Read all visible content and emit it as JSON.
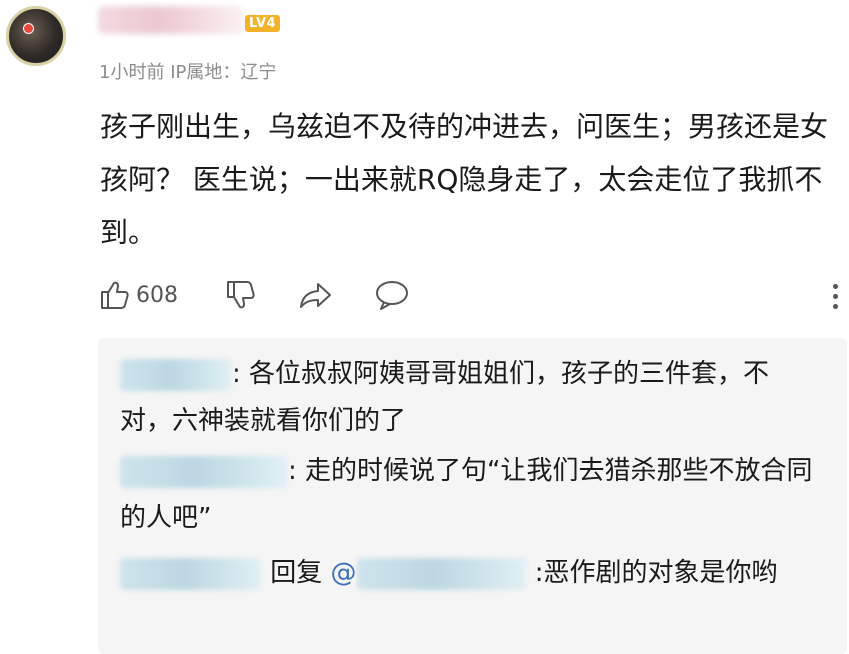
{
  "post": {
    "level_badge": "LV4",
    "meta_time": "1小时前",
    "meta_location": "IP属地：辽宁",
    "body": "孩子刚出生，乌兹迫不及待的冲进去，问医生；男孩还是女孩阿？ 医生说；一出来就RQ隐身走了，太会走位了我抓不到。",
    "likes": "608"
  },
  "replies": [
    {
      "text": ": 各位叔叔阿姨哥哥姐姐们，孩子的三件套，不对，六神装就看你们的了"
    },
    {
      "text": ": 走的时候说了句“让我们去猎杀那些不放合同的人吧”"
    },
    {
      "reply_word": " 回复 ",
      "mention_at": "@",
      "text": " :恶作剧的对象是你哟"
    }
  ],
  "colors": {
    "level_badge": "#f2b32a",
    "meta": "#8c8c8c",
    "reply_background": "#f5f5f5",
    "mention": "#3b6fb6"
  },
  "icons": [
    "thumbs-up-icon",
    "thumbs-down-icon",
    "share-icon",
    "comment-icon",
    "more-vertical-icon"
  ]
}
